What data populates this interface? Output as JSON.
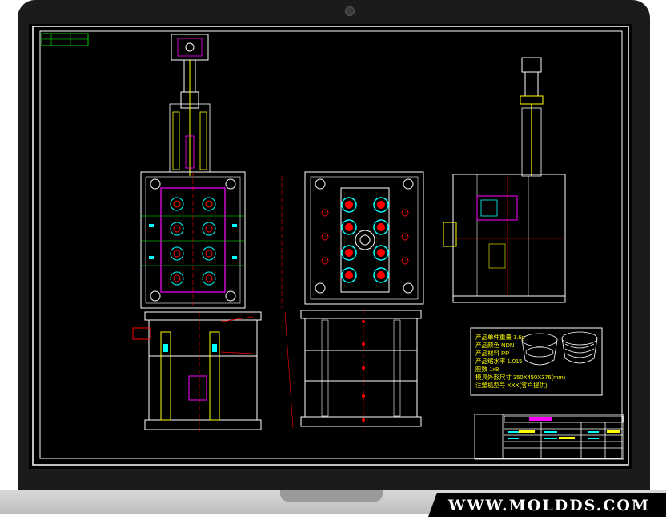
{
  "watermark": "WWW.MOLDDS.COM",
  "spec_note": {
    "lines": [
      "产品单件重量 1.6g",
      "产品颜色  NDN",
      "产品材料  PP",
      "产品缩水率 1.015",
      "腔数    1x8",
      "模具外形尺寸 350X450X376(mm)",
      "注塑机型号  XXX(客户提供)"
    ]
  },
  "colors": {
    "background": "#000000",
    "border": "#ffffff",
    "cyan": "#00ffff",
    "yellow": "#ffff00",
    "green": "#00ff00",
    "red": "#ff0000",
    "magenta": "#ff00ff"
  }
}
